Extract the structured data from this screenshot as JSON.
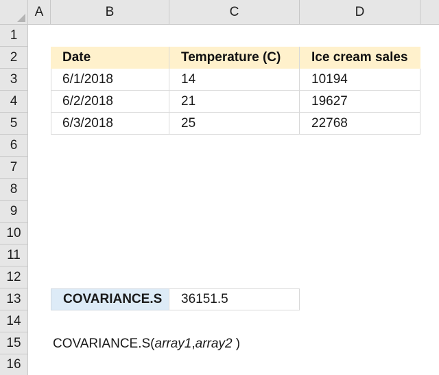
{
  "columns": [
    "A",
    "B",
    "C",
    "D"
  ],
  "rows": [
    "1",
    "2",
    "3",
    "4",
    "5",
    "6",
    "7",
    "8",
    "9",
    "10",
    "11",
    "12",
    "13",
    "14",
    "15",
    "16"
  ],
  "table": {
    "headers": [
      "Date",
      "Temperature (C)",
      "Ice cream sales"
    ],
    "rows": [
      [
        "6/1/2018",
        "14",
        "10194"
      ],
      [
        "6/2/2018",
        "21",
        "19627"
      ],
      [
        "6/3/2018",
        "25",
        "22768"
      ]
    ]
  },
  "result": {
    "label": "COVARIANCE.S",
    "value": "36151.5"
  },
  "syntax": {
    "func": "COVARIANCE.S(",
    "arg1": "array1",
    "comma": ",",
    "arg2": "array2",
    "close": " )"
  },
  "colors": {
    "header_fill": "#fff1cc",
    "label_fill": "#ddebf7",
    "grid_line": "#d9d9d9"
  }
}
